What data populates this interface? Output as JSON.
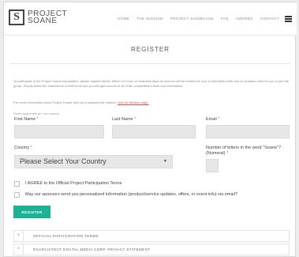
{
  "header": {
    "logo_mark": "S",
    "logo_line1": "PROJECT",
    "logo_line2": "SOANE",
    "nav": [
      "HOME",
      "THE MISSION",
      "PROJECT SHOWCASE",
      "FAQ",
      "AWARDS",
      "CONTACT"
    ]
  },
  "page_title": "REGISTER",
  "intro_text": "To participate in the Project Soane competition, please register below. Within 24 hours on business days an account will be created for you on Autodesk A360 and an invitation sent for you to join the group. Simply follow the instructions in that email and you will gain access to all of the competition's tools and information.",
  "more_info": {
    "text": "For more information about Project Soane and our crowdsourced mission,",
    "link": "visit our Mission page."
  },
  "required_note": {
    "text": "Fields marked with an",
    "star": "*",
    "suffix": "are required"
  },
  "form": {
    "first_name_label": "First Name",
    "last_name_label": "Last Name",
    "email_label": "Email",
    "required_star": "*",
    "country_label": "Country",
    "country_selected": "Please Select Your Country",
    "letters_label_line1": "Number of letters in the word \"Soane\"?",
    "letters_label_line2": "(Numeral)"
  },
  "checkboxes": {
    "agree_label": "I AGREE to the Official Project Participation Terms",
    "sponsors_label": "May our sponsors send you personalized information (product/service updates, offers, or event info) via email?"
  },
  "register_button": "REGISTER",
  "accordions": [
    {
      "icon": "+",
      "label": "OFFICIAL PARTICIPATION TERMS"
    },
    {
      "icon": "+",
      "label": "DSARCHITECT DIGITAL MEDIA CORP. PRIVACY STATEMENT"
    }
  ],
  "colors": {
    "accent": "#1ab394",
    "required": "#d9534f",
    "field_bg": "#e7e7e7"
  },
  "icons": {
    "menu": "hamburger-menu-icon",
    "select_arrow": "dropdown-arrow-icon",
    "accordion": "plus-icon"
  }
}
